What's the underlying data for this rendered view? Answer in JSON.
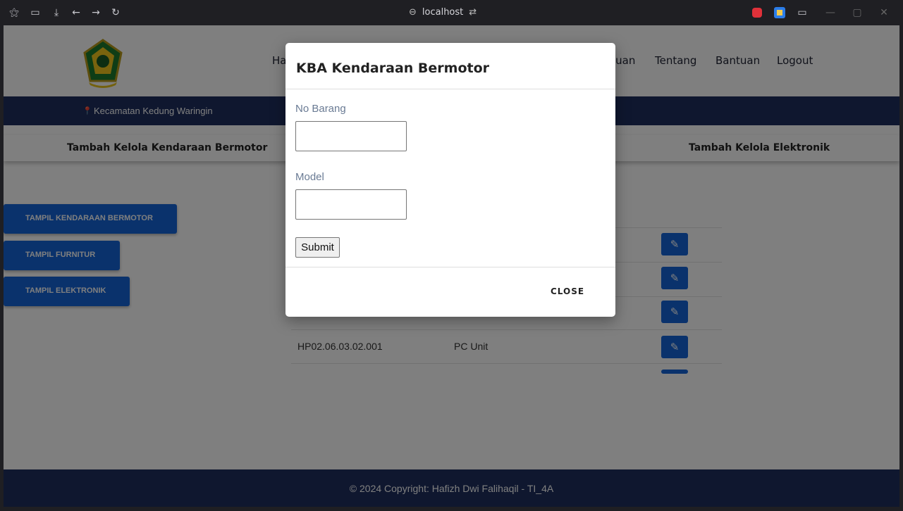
{
  "browser": {
    "url": "localhost",
    "icons": [
      "extensions-icon",
      "sidebar-icon",
      "download-icon",
      "back-icon",
      "forward-icon",
      "reload-icon"
    ]
  },
  "site": {
    "nav": {
      "partial_left": "Ha",
      "partial_right": "luan",
      "items": [
        "Tentang",
        "Bantuan",
        "Logout"
      ]
    },
    "location": "Kecamatan Kedung Waringin",
    "tabs": {
      "left": "Tambah Kelola Kendaraan Bermotor",
      "right": "Tambah Kelola Elektronik"
    },
    "side_buttons": [
      "TAMPIL KENDARAAN BERMOTOR",
      "TAMPIL FURNITUR",
      "TAMPIL ELEKTRONIK"
    ],
    "table_rows": [
      {
        "no_barang": "HP02.06.03.02.001",
        "nama": "PC Unit"
      }
    ],
    "footer": "© 2024 Copyright: Hafizh Dwi Falihaqil - TI_4A"
  },
  "modal": {
    "title": "KBA Kendaraan Bermotor",
    "fields": [
      {
        "label": "No Barang",
        "value": ""
      },
      {
        "label": "Model",
        "value": ""
      }
    ],
    "submit_label": "Submit",
    "close_label": "CLOSE"
  },
  "colors": {
    "navy": "#1e2f5e",
    "button_blue": "#1565d8",
    "label_gray_blue": "#6a7b94"
  }
}
